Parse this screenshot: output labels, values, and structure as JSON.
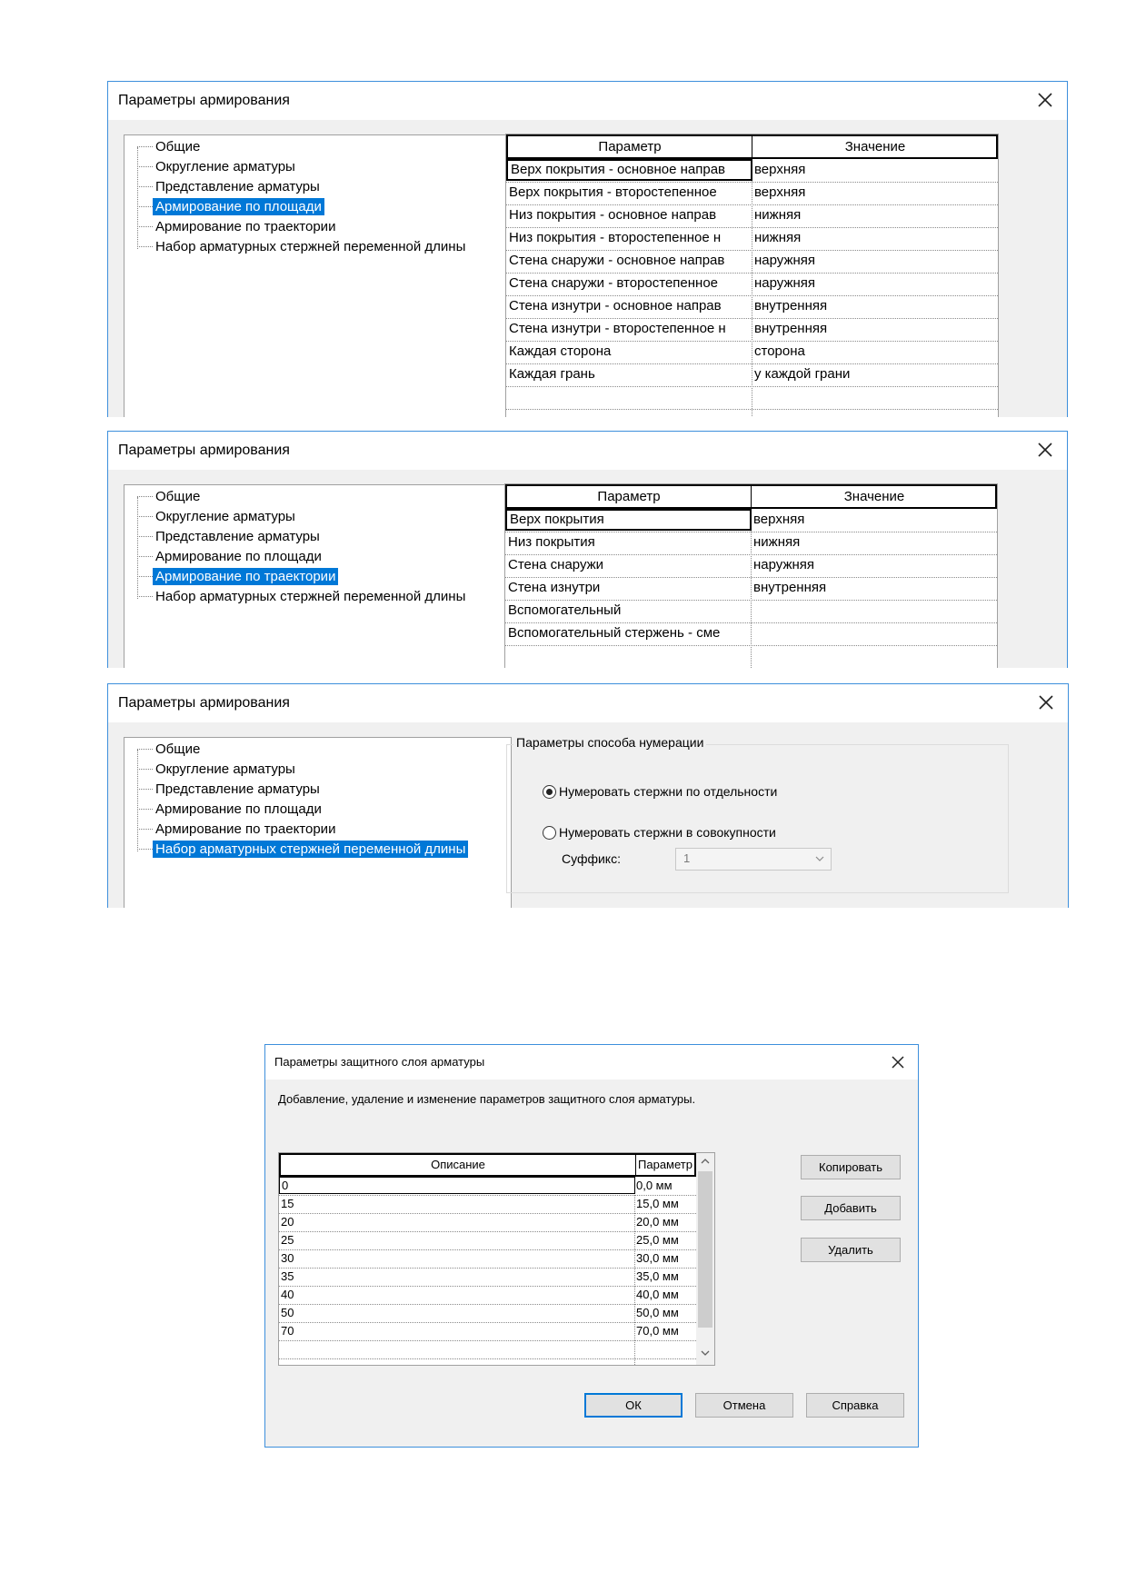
{
  "tree_items": [
    "Общие",
    "Округление арматуры",
    "Представление арматуры",
    "Армирование по площади",
    "Армирование по траектории",
    "Набор арматурных стержней переменной длины"
  ],
  "dialog1": {
    "title": "Параметры армирования",
    "selected_tree_item": "Армирование по площади",
    "grid": {
      "headers": [
        "Параметр",
        "Значение"
      ],
      "rows": [
        {
          "param": "Верх покрытия - основное направ",
          "value": "верхняя"
        },
        {
          "param": "Верх покрытия - второстепенное",
          "value": "верхняя"
        },
        {
          "param": "Низ покрытия - основное направ",
          "value": "нижняя"
        },
        {
          "param": "Низ покрытия - второстепенное н",
          "value": "нижняя"
        },
        {
          "param": "Стена снаружи - основное направ",
          "value": "наружняя"
        },
        {
          "param": "Стена снаружи - второстепенное",
          "value": "наружняя"
        },
        {
          "param": "Стена изнутри - основное направ",
          "value": "внутренняя"
        },
        {
          "param": "Стена изнутри - второстепенное н",
          "value": "внутренняя"
        },
        {
          "param": "Каждая сторона",
          "value": "сторона"
        },
        {
          "param": "Каждая грань",
          "value": "у каждой грани"
        }
      ]
    }
  },
  "dialog2": {
    "title": "Параметры армирования",
    "selected_tree_item": "Армирование по траектории",
    "grid": {
      "headers": [
        "Параметр",
        "Значение"
      ],
      "rows": [
        {
          "param": "Верх покрытия",
          "value": "верхняя"
        },
        {
          "param": "Низ покрытия",
          "value": "нижняя"
        },
        {
          "param": "Стена снаружи",
          "value": "наружняя"
        },
        {
          "param": "Стена изнутри",
          "value": "внутренняя"
        },
        {
          "param": "Вспомогательный",
          "value": ""
        },
        {
          "param": "Вспомогательный стержень - сме",
          "value": ""
        }
      ]
    }
  },
  "dialog3": {
    "title": "Параметры армирования",
    "selected_tree_item": "Набор арматурных стержней переменной длины",
    "group_label": "Параметры способа нумерации",
    "radio_separate": "Нумеровать стержни по отдельности",
    "radio_combined": "Нумеровать стержни в совокупности",
    "suffix_label": "Суффикс:",
    "suffix_value": "1"
  },
  "dialog4": {
    "title": "Параметры защитного слоя арматуры",
    "description": "Добавление, удаление и изменение параметров защитного слоя арматуры.",
    "headers": [
      "Описание",
      "Параметр"
    ],
    "rows": [
      {
        "desc": "0",
        "param": "0,0 мм"
      },
      {
        "desc": "15",
        "param": "15,0 мм"
      },
      {
        "desc": "20",
        "param": "20,0 мм"
      },
      {
        "desc": "25",
        "param": "25,0 мм"
      },
      {
        "desc": "30",
        "param": "30,0 мм"
      },
      {
        "desc": "35",
        "param": "35,0 мм"
      },
      {
        "desc": "40",
        "param": "40,0 мм"
      },
      {
        "desc": "50",
        "param": "50,0 мм"
      },
      {
        "desc": "70",
        "param": "70,0 мм"
      }
    ],
    "copy_label": "Копировать",
    "add_label": "Добавить",
    "delete_label": "Удалить",
    "ok_label": "ОК",
    "cancel_label": "Отмена",
    "help_label": "Справка"
  },
  "icons": {
    "close": "close-icon",
    "scroll_up": "chevron-up-icon",
    "scroll_down": "chevron-down-icon",
    "dropdown": "chevron-down-icon"
  }
}
